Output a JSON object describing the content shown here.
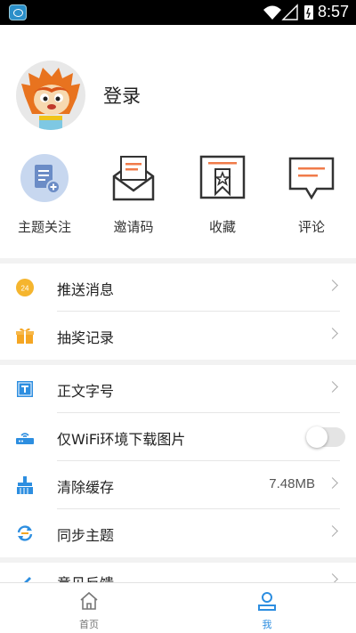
{
  "status_bar": {
    "time": "8:57"
  },
  "profile": {
    "login_label": "登录"
  },
  "quick_actions": [
    {
      "label": "主题关注",
      "icon": "topic-follow-icon"
    },
    {
      "label": "邀请码",
      "icon": "invite-code-icon"
    },
    {
      "label": "收藏",
      "icon": "favorite-icon"
    },
    {
      "label": "评论",
      "icon": "comment-icon"
    }
  ],
  "menu": {
    "push": {
      "label": "推送消息"
    },
    "lottery": {
      "label": "抽奖记录"
    },
    "font_size": {
      "label": "正文字号"
    },
    "wifi_images": {
      "label": "仅WiFi环境下载图片",
      "enabled": false
    },
    "clear_cache": {
      "label": "清除缓存",
      "value": "7.48MB"
    },
    "sync": {
      "label": "同步主题"
    },
    "feedback": {
      "label": "意见反馈"
    }
  },
  "nav": {
    "home": "首页",
    "me": "我"
  },
  "colors": {
    "accent": "#2d8ee0",
    "orange": "#f5a623",
    "inactive": "#777777"
  }
}
